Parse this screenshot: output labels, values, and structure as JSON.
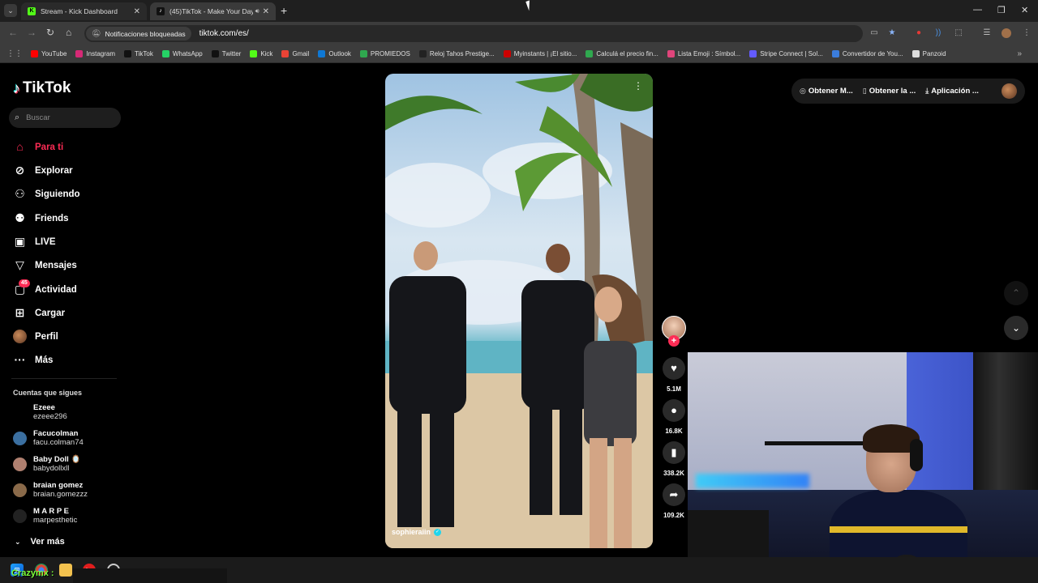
{
  "browser": {
    "tabs": [
      {
        "title": "Stream - Kick Dashboard",
        "favicon": "kick-icon"
      },
      {
        "title": "(45)TikTok - Make Your Day",
        "favicon": "tiktok-icon",
        "audio": true
      }
    ],
    "notifications_chip": "Notificaciones bloqueadas",
    "url": "tiktok.com/es/",
    "bookmarks": [
      {
        "label": "YouTube",
        "icon": "youtube-icon",
        "color": "#ff0000"
      },
      {
        "label": "Instagram",
        "icon": "instagram-icon",
        "color": "#d62976"
      },
      {
        "label": "TikTok",
        "icon": "tiktok-icon",
        "color": "#111111"
      },
      {
        "label": "WhatsApp",
        "icon": "whatsapp-icon",
        "color": "#25d366"
      },
      {
        "label": "Twitter",
        "icon": "x-icon",
        "color": "#111111"
      },
      {
        "label": "Kick",
        "icon": "kick-icon",
        "color": "#53fc18"
      },
      {
        "label": "Gmail",
        "icon": "gmail-icon",
        "color": "#ea4335"
      },
      {
        "label": "Outlook",
        "icon": "outlook-icon",
        "color": "#0f78d4"
      },
      {
        "label": "PROMIEDOS",
        "icon": "promiedos-icon",
        "color": "#2fa84f"
      },
      {
        "label": "Reloj Tahos Prestige...",
        "icon": "reloj-icon",
        "color": "#222222"
      },
      {
        "label": "Myinstants | ¡El sitio...",
        "icon": "myinstants-icon",
        "color": "#cc0000"
      },
      {
        "label": "Calculá el precio fin...",
        "icon": "calc-icon",
        "color": "#2fa84f"
      },
      {
        "label": "Lista Emoji : Símbol...",
        "icon": "emoji-icon",
        "color": "#e0457b"
      },
      {
        "label": "Stripe Connect | Sol...",
        "icon": "stripe-icon",
        "color": "#635bff"
      },
      {
        "label": "Convertidor de You...",
        "icon": "converter-icon",
        "color": "#3b7ddd"
      },
      {
        "label": "Panzoid",
        "icon": "panzoid-icon",
        "color": "#dddddd"
      }
    ]
  },
  "tiktok": {
    "logo": "TikTok",
    "search_placeholder": "Buscar",
    "nav": [
      {
        "label": "Para ti",
        "icon": "home-icon"
      },
      {
        "label": "Explorar",
        "icon": "compass-icon"
      },
      {
        "label": "Siguiendo",
        "icon": "following-icon"
      },
      {
        "label": "Friends",
        "icon": "friends-icon"
      },
      {
        "label": "LIVE",
        "icon": "live-icon"
      },
      {
        "label": "Mensajes",
        "icon": "messages-icon"
      },
      {
        "label": "Actividad",
        "icon": "activity-icon",
        "badge": "45"
      },
      {
        "label": "Cargar",
        "icon": "upload-icon"
      },
      {
        "label": "Perfil",
        "icon": "avatar"
      },
      {
        "label": "Más",
        "icon": "more-icon"
      }
    ],
    "following_title": "Cuentas que sigues",
    "following": [
      {
        "name": "Ezeee",
        "handle": "ezeee296",
        "color": "#000000"
      },
      {
        "name": "Facucolman",
        "handle": "facu.colman74",
        "color": "#3b6fa0"
      },
      {
        "name": "Baby Doll 🪞",
        "handle": "babydollxll",
        "color": "#b08070"
      },
      {
        "name": "braian gomez",
        "handle": "braian.gomezzz",
        "color": "#8a6a4a"
      },
      {
        "name": "M A R P E",
        "handle": "marpesthetic",
        "color": "#222222"
      }
    ],
    "see_more": "Ver más",
    "top_actions": [
      {
        "label": "Obtener M...",
        "icon": "coin-icon"
      },
      {
        "label": "Obtener la ...",
        "icon": "phone-icon"
      },
      {
        "label": "Aplicación ...",
        "icon": "download-icon"
      }
    ],
    "video": {
      "creator": "sophieraiin",
      "likes": "5.1M",
      "comments": "16.8K",
      "saves": "338.2K",
      "shares": "109.2K"
    }
  },
  "overlay": {
    "streamer_tag": "Crazymx :"
  }
}
